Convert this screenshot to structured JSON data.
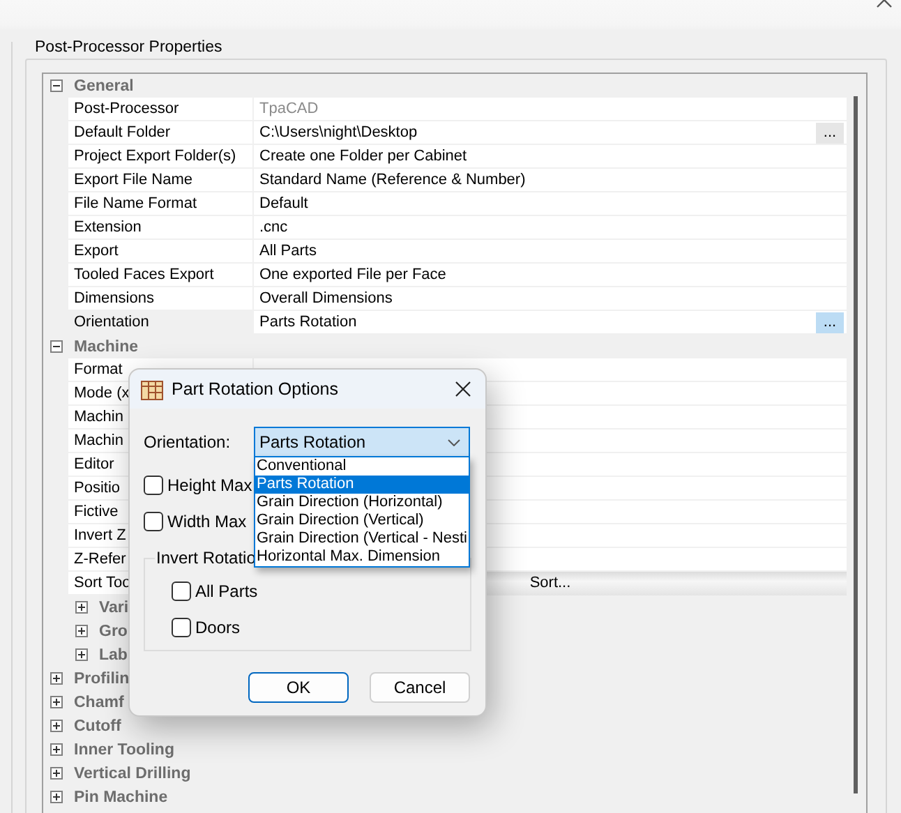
{
  "group_title": "Post-Processor Properties",
  "categories": [
    {
      "name": "General",
      "expanded": true,
      "properties": [
        {
          "name": "Post-Processor",
          "value": "TpaCAD",
          "kind": "text",
          "disabled": true,
          "selected": false
        },
        {
          "name": "Default Folder",
          "value": "C:\\Users\\night\\Desktop",
          "kind": "browse",
          "button_label": "...",
          "disabled": false,
          "selected": false
        },
        {
          "name": "Project Export Folder(s)",
          "value": "Create one Folder per Cabinet",
          "kind": "text",
          "disabled": false,
          "selected": false
        },
        {
          "name": "Export File Name",
          "value": "Standard Name (Reference & Number)",
          "kind": "text",
          "disabled": false,
          "selected": false
        },
        {
          "name": "File Name Format",
          "value": "Default",
          "kind": "text",
          "disabled": false,
          "selected": false
        },
        {
          "name": "Extension",
          "value": ".cnc",
          "kind": "text",
          "disabled": false,
          "selected": false
        },
        {
          "name": "Export",
          "value": "All Parts",
          "kind": "text",
          "disabled": false,
          "selected": false
        },
        {
          "name": "Tooled Faces Export",
          "value": "One exported File per Face",
          "kind": "text",
          "disabled": false,
          "selected": false
        },
        {
          "name": "Dimensions",
          "value": "Overall Dimensions",
          "kind": "text",
          "disabled": false,
          "selected": false
        },
        {
          "name": "Orientation",
          "value": "Parts Rotation",
          "kind": "browse",
          "button_label": "...",
          "disabled": false,
          "selected": true
        }
      ]
    },
    {
      "name": "Machine",
      "expanded": true,
      "properties": [
        {
          "name": "Format",
          "kind": "text",
          "selected": false
        },
        {
          "name": "Mode (x",
          "kind": "text",
          "selected": false
        },
        {
          "name": "Machin",
          "kind": "text",
          "selected": false
        },
        {
          "name": "Machin",
          "kind": "text",
          "selected": false
        },
        {
          "name": "Editor",
          "kind": "text",
          "selected": false
        },
        {
          "name": "Positio",
          "kind": "text",
          "selected": false
        },
        {
          "name": "Fictive",
          "kind": "text",
          "selected": false
        },
        {
          "name": "Invert Z",
          "kind": "text",
          "selected": false
        },
        {
          "name": "Z-Refer",
          "kind": "text",
          "selected": false
        },
        {
          "name": "Sort Too",
          "value": "Sort...",
          "kind": "button",
          "selected": false
        }
      ],
      "children": [
        {
          "name": "Vari",
          "expanded": false
        },
        {
          "name": "Gro",
          "expanded": false
        },
        {
          "name": "Lab",
          "expanded": false
        }
      ]
    },
    {
      "name": "Profilin",
      "expanded": false
    },
    {
      "name": "Chamf",
      "expanded": false
    },
    {
      "name": "Cutoff",
      "expanded": false
    },
    {
      "name": "Inner Tooling",
      "expanded": false
    },
    {
      "name": "Vertical Drilling",
      "expanded": false
    },
    {
      "name": "Pin Machine",
      "expanded": false
    }
  ],
  "dialog": {
    "title": "Part Rotation Options",
    "orientation_label": "Orientation:",
    "orientation_value": "Parts Rotation",
    "dropdown": {
      "expanded": true,
      "options": [
        {
          "label": "Conventional",
          "selected": false
        },
        {
          "label": "Parts Rotation",
          "selected": true
        },
        {
          "label": "Grain Direction (Horizontal)",
          "selected": false
        },
        {
          "label": "Grain Direction (Vertical)",
          "selected": false
        },
        {
          "label": "Grain Direction (Vertical - Nesti",
          "selected": false
        },
        {
          "label": "Horizontal Max. Dimension",
          "selected": false
        }
      ]
    },
    "checkboxes": [
      {
        "label": "Height Max",
        "checked": false
      },
      {
        "label": "Width Max",
        "checked": false
      }
    ],
    "invert_group": {
      "title": "Invert Rotatio",
      "checkboxes": [
        {
          "label": "All Parts",
          "checked": false
        },
        {
          "label": "Doors",
          "checked": false
        }
      ]
    },
    "buttons": [
      {
        "label": "OK",
        "default": true
      },
      {
        "label": "Cancel",
        "default": false
      }
    ]
  }
}
